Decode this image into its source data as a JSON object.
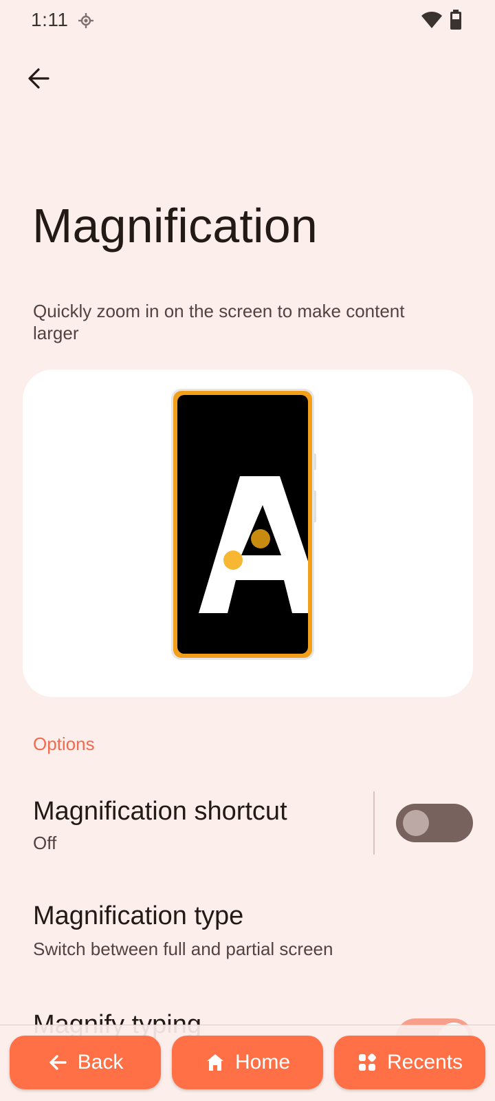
{
  "status_bar": {
    "time": "1:11"
  },
  "header": {
    "title": "Magnification",
    "description": "Quickly zoom in on the screen to make content larger"
  },
  "sections": {
    "options_header": "Options"
  },
  "preferences": {
    "shortcut": {
      "title": "Magnification shortcut",
      "summary": "Off",
      "toggle_on": false
    },
    "type": {
      "title": "Magnification type",
      "summary": "Switch between full and partial screen"
    },
    "typing": {
      "title": "Magnify typing",
      "toggle_on": true
    }
  },
  "nav": {
    "back_label": "Back",
    "home_label": "Home",
    "recents_label": "Recents"
  },
  "colors": {
    "background": "#fbeeeb",
    "accent": "#ff7046",
    "section_header": "#f26a4f",
    "illustration_frame": "#f29f1b"
  }
}
